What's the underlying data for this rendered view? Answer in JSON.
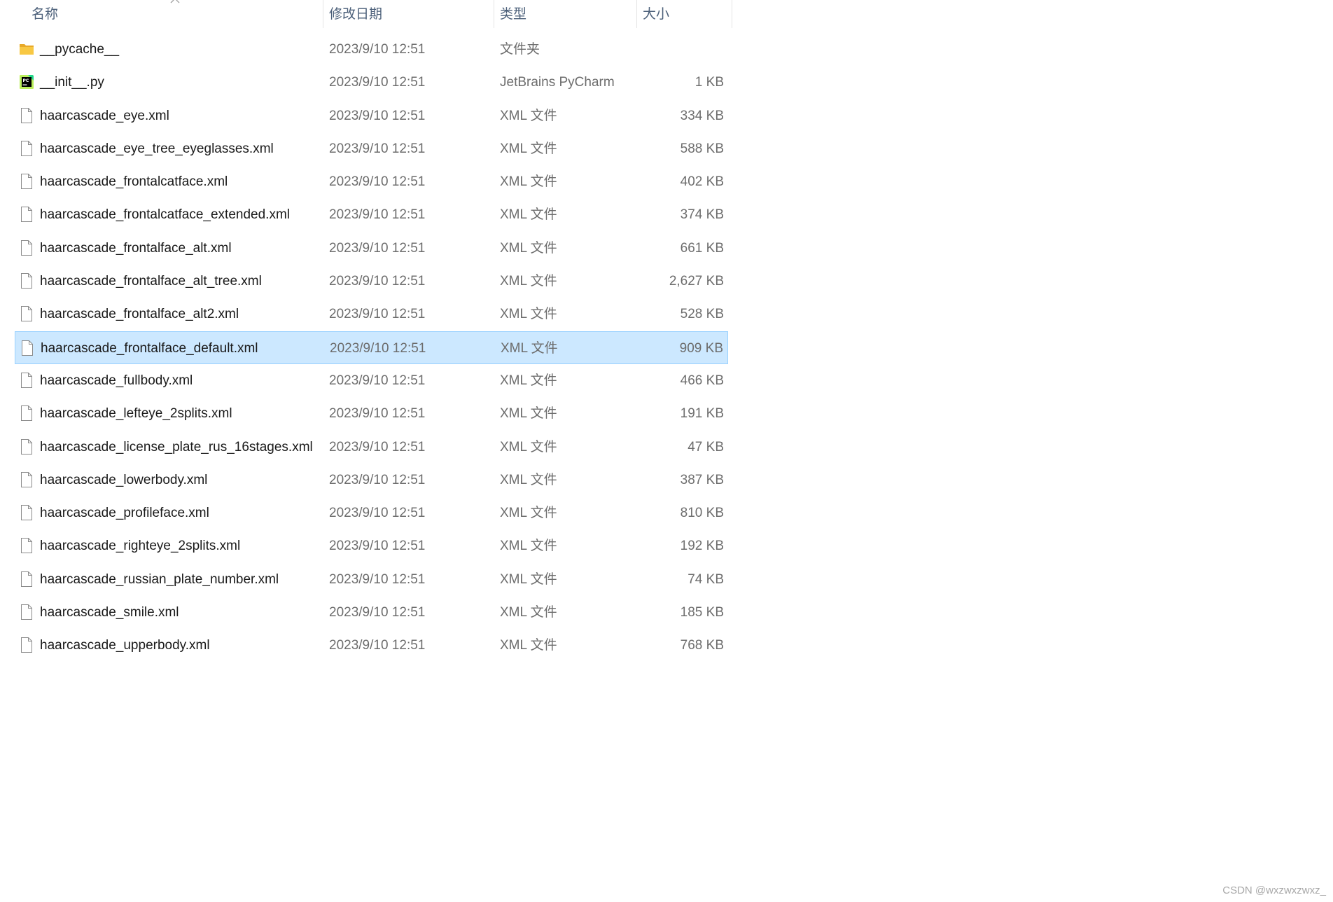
{
  "columns": {
    "name": "名称",
    "date": "修改日期",
    "type": "类型",
    "size": "大小"
  },
  "files": [
    {
      "name": "__pycache__",
      "date": "2023/9/10 12:51",
      "type": "文件夹",
      "size": "",
      "icon": "folder-icon"
    },
    {
      "name": "__init__.py",
      "date": "2023/9/10 12:51",
      "type": "JetBrains PyCharm",
      "size": "1 KB",
      "icon": "pycharm-icon"
    },
    {
      "name": "haarcascade_eye.xml",
      "date": "2023/9/10 12:51",
      "type": "XML 文件",
      "size": "334 KB",
      "icon": "file-icon"
    },
    {
      "name": "haarcascade_eye_tree_eyeglasses.xml",
      "date": "2023/9/10 12:51",
      "type": "XML 文件",
      "size": "588 KB",
      "icon": "file-icon"
    },
    {
      "name": "haarcascade_frontalcatface.xml",
      "date": "2023/9/10 12:51",
      "type": "XML 文件",
      "size": "402 KB",
      "icon": "file-icon"
    },
    {
      "name": "haarcascade_frontalcatface_extended.xml",
      "date": "2023/9/10 12:51",
      "type": "XML 文件",
      "size": "374 KB",
      "icon": "file-icon"
    },
    {
      "name": "haarcascade_frontalface_alt.xml",
      "date": "2023/9/10 12:51",
      "type": "XML 文件",
      "size": "661 KB",
      "icon": "file-icon"
    },
    {
      "name": "haarcascade_frontalface_alt_tree.xml",
      "date": "2023/9/10 12:51",
      "type": "XML 文件",
      "size": "2,627 KB",
      "icon": "file-icon"
    },
    {
      "name": "haarcascade_frontalface_alt2.xml",
      "date": "2023/9/10 12:51",
      "type": "XML 文件",
      "size": "528 KB",
      "icon": "file-icon"
    },
    {
      "name": "haarcascade_frontalface_default.xml",
      "date": "2023/9/10 12:51",
      "type": "XML 文件",
      "size": "909 KB",
      "icon": "file-icon",
      "selected": true
    },
    {
      "name": "haarcascade_fullbody.xml",
      "date": "2023/9/10 12:51",
      "type": "XML 文件",
      "size": "466 KB",
      "icon": "file-icon"
    },
    {
      "name": "haarcascade_lefteye_2splits.xml",
      "date": "2023/9/10 12:51",
      "type": "XML 文件",
      "size": "191 KB",
      "icon": "file-icon"
    },
    {
      "name": "haarcascade_license_plate_rus_16stages.xml",
      "date": "2023/9/10 12:51",
      "type": "XML 文件",
      "size": "47 KB",
      "icon": "file-icon"
    },
    {
      "name": "haarcascade_lowerbody.xml",
      "date": "2023/9/10 12:51",
      "type": "XML 文件",
      "size": "387 KB",
      "icon": "file-icon"
    },
    {
      "name": "haarcascade_profileface.xml",
      "date": "2023/9/10 12:51",
      "type": "XML 文件",
      "size": "810 KB",
      "icon": "file-icon"
    },
    {
      "name": "haarcascade_righteye_2splits.xml",
      "date": "2023/9/10 12:51",
      "type": "XML 文件",
      "size": "192 KB",
      "icon": "file-icon"
    },
    {
      "name": "haarcascade_russian_plate_number.xml",
      "date": "2023/9/10 12:51",
      "type": "XML 文件",
      "size": "74 KB",
      "icon": "file-icon"
    },
    {
      "name": "haarcascade_smile.xml",
      "date": "2023/9/10 12:51",
      "type": "XML 文件",
      "size": "185 KB",
      "icon": "file-icon"
    },
    {
      "name": "haarcascade_upperbody.xml",
      "date": "2023/9/10 12:51",
      "type": "XML 文件",
      "size": "768 KB",
      "icon": "file-icon"
    }
  ],
  "watermark": "CSDN @wxzwxzwxz_",
  "colors": {
    "selected_bg": "#cce8ff",
    "selected_border": "#99d1ff",
    "header_text": "#4c607a",
    "folder": "#f8c843"
  }
}
